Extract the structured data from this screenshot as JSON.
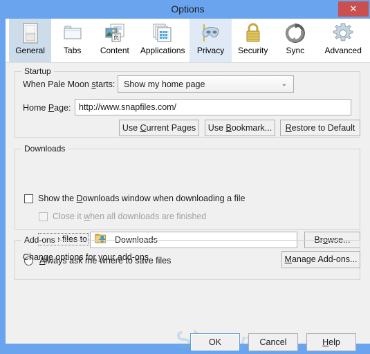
{
  "window": {
    "title": "Options",
    "close_label": "✕"
  },
  "tabs": [
    {
      "label": "General",
      "icon": "window-icon",
      "state": "selected"
    },
    {
      "label": "Tabs",
      "icon": "folder-tab-icon",
      "state": "normal"
    },
    {
      "label": "Content",
      "icon": "content-page-icon",
      "state": "normal"
    },
    {
      "label": "Applications",
      "icon": "applications-icon",
      "state": "normal"
    },
    {
      "label": "Privacy",
      "icon": "mask-icon",
      "state": "hover"
    },
    {
      "label": "Security",
      "icon": "padlock-icon",
      "state": "normal"
    },
    {
      "label": "Sync",
      "icon": "sync-arrows-icon",
      "state": "normal"
    },
    {
      "label": "Advanced",
      "icon": "gear-icon",
      "state": "normal"
    }
  ],
  "startup": {
    "group_title": "Startup",
    "startup_label": "When Pale Moon starts:",
    "startup_label_pre": "When Pale Moon ",
    "startup_label_accel": "s",
    "startup_label_post": "tarts:",
    "startup_value": "Show my home page",
    "startup_options": [
      "Show my home page"
    ],
    "dropdown_arrow": "⌄",
    "homepage_label_pre": "Home ",
    "homepage_label_accel": "P",
    "homepage_label_post": "age:",
    "homepage_value": "http://www.snapfiles.com/",
    "buttons": {
      "use_current_pages": {
        "pre": "Use ",
        "accel": "C",
        "post": "urrent Pages"
      },
      "use_bookmark": {
        "pre": "Use ",
        "accel": "B",
        "post": "ookmark..."
      },
      "restore_default": {
        "pre": "",
        "accel": "R",
        "post": "estore to Default"
      }
    }
  },
  "downloads": {
    "group_title": "Downloads",
    "show_window": {
      "pre": "Show the ",
      "accel": "D",
      "post": "ownloads window when downloading a file",
      "checked": false,
      "disabled": false
    },
    "close_when_finished": {
      "pre": "Close it ",
      "accel": "w",
      "post": "hen all downloads are finished",
      "checked": false,
      "disabled": true
    },
    "save_files_to": {
      "pre": "Sa",
      "accel": "v",
      "post": "e files to",
      "selected": true
    },
    "folder_value": "Downloads",
    "folder_icon": "download-folder-icon",
    "browse_button": {
      "pre": "Br",
      "accel": "o",
      "post": "wse..."
    },
    "always_ask": {
      "pre": "",
      "accel": "A",
      "post": "lways ask me where to save files",
      "selected": false
    }
  },
  "addons": {
    "group_title": "Add-ons",
    "description": "Change options for your add-ons",
    "manage_button": {
      "pre": "",
      "accel": "M",
      "post": "anage Add-ons..."
    }
  },
  "footer": {
    "ok": "OK",
    "cancel": "Cancel",
    "help_pre": "",
    "help_accel": "H",
    "help_post": "elp"
  },
  "watermark": {
    "text": "SnapFiles",
    "logo_letter": "S"
  },
  "colors": {
    "titlebar": "#6aa4ee",
    "close_button": "#c9504f",
    "dialog_bg": "#f0f0f0",
    "tabstrip_bg": "#ffffff",
    "tab_selected": "#cddceb",
    "tab_hover": "#dfeaf6",
    "default_button_border": "#5d9fd8",
    "disabled_text": "#a0a0a0"
  }
}
